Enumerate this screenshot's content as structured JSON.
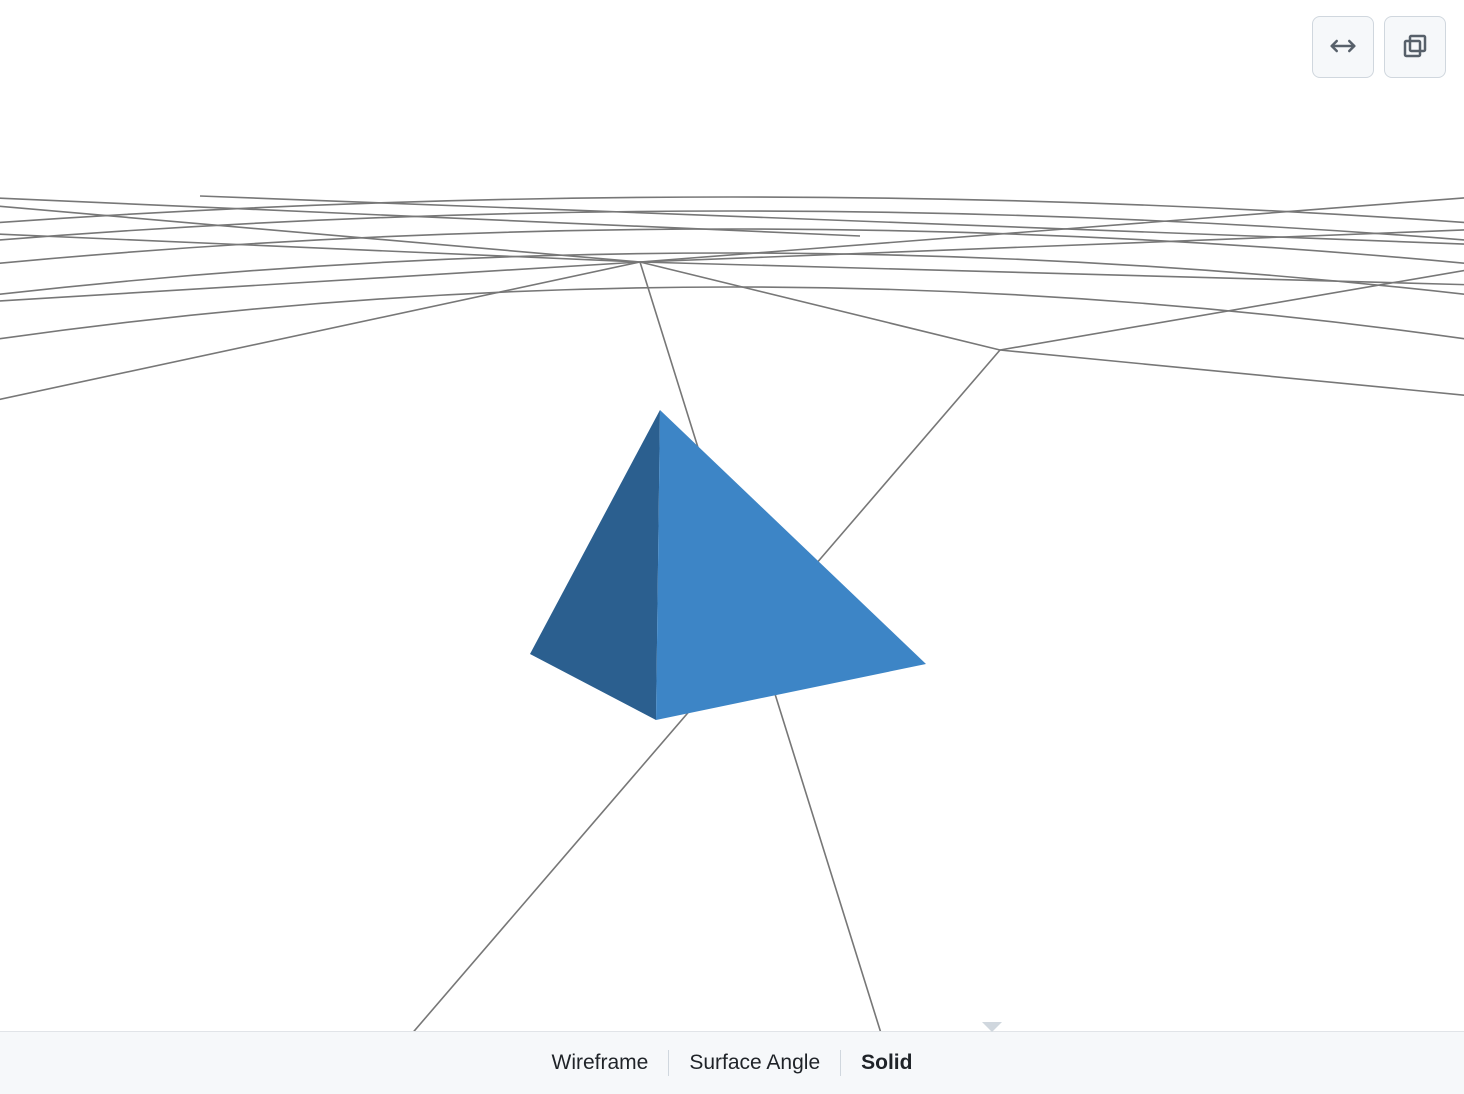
{
  "toolbar": {
    "expand_button": "expand-horizontal",
    "popout_button": "popout-window"
  },
  "view_modes": {
    "options": [
      {
        "id": "wireframe",
        "label": "Wireframe",
        "active": false
      },
      {
        "id": "surface_angle",
        "label": "Surface Angle",
        "active": false
      },
      {
        "id": "solid",
        "label": "Solid",
        "active": true
      }
    ]
  },
  "model": {
    "render_mode": "Solid",
    "shape": "tetrahedron",
    "face_colors": {
      "left_face": "#2b5f8f",
      "right_face": "#3d85c6"
    },
    "grid_line_color": "#777777"
  }
}
